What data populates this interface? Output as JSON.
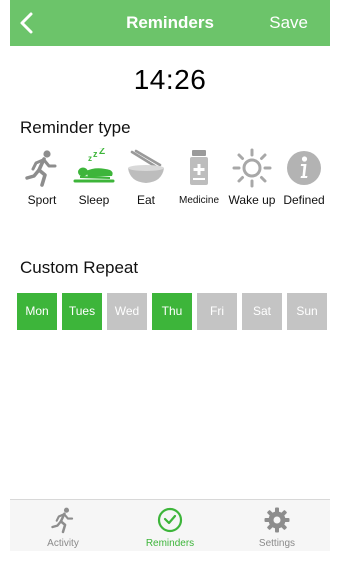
{
  "header": {
    "title": "Reminders",
    "save_label": "Save",
    "background_color": "#6cc46a",
    "icons": {
      "back": "chevron-left-icon"
    }
  },
  "time": "14:26",
  "reminder_type": {
    "title": "Reminder type",
    "selected": "Sleep",
    "items": [
      {
        "label": "Sport",
        "icon": "running-person-icon"
      },
      {
        "label": "Sleep",
        "icon": "sleeping-person-icon",
        "color": "#3db53a"
      },
      {
        "label": "Eat",
        "icon": "bowl-chopsticks-icon"
      },
      {
        "label": "Medicine",
        "icon": "medicine-bottle-icon"
      },
      {
        "label": "Wake up",
        "icon": "sun-icon"
      },
      {
        "label": "Defined",
        "icon": "info-icon"
      }
    ]
  },
  "custom_repeat": {
    "title": "Custom Repeat",
    "on_color": "#3db53a",
    "off_color": "#c4c4c4",
    "days": [
      {
        "label": "Mon",
        "selected": true
      },
      {
        "label": "Tues",
        "selected": true
      },
      {
        "label": "Wed",
        "selected": false
      },
      {
        "label": "Thu",
        "selected": true
      },
      {
        "label": "Fri",
        "selected": false
      },
      {
        "label": "Sat",
        "selected": false
      },
      {
        "label": "Sun",
        "selected": false
      }
    ]
  },
  "tabbar": {
    "active": "Reminders",
    "active_color": "#3db53a",
    "items": [
      {
        "label": "Activity",
        "icon": "running-person-icon"
      },
      {
        "label": "Reminders",
        "icon": "clock-check-icon"
      },
      {
        "label": "Settings",
        "icon": "gear-icon"
      }
    ]
  }
}
